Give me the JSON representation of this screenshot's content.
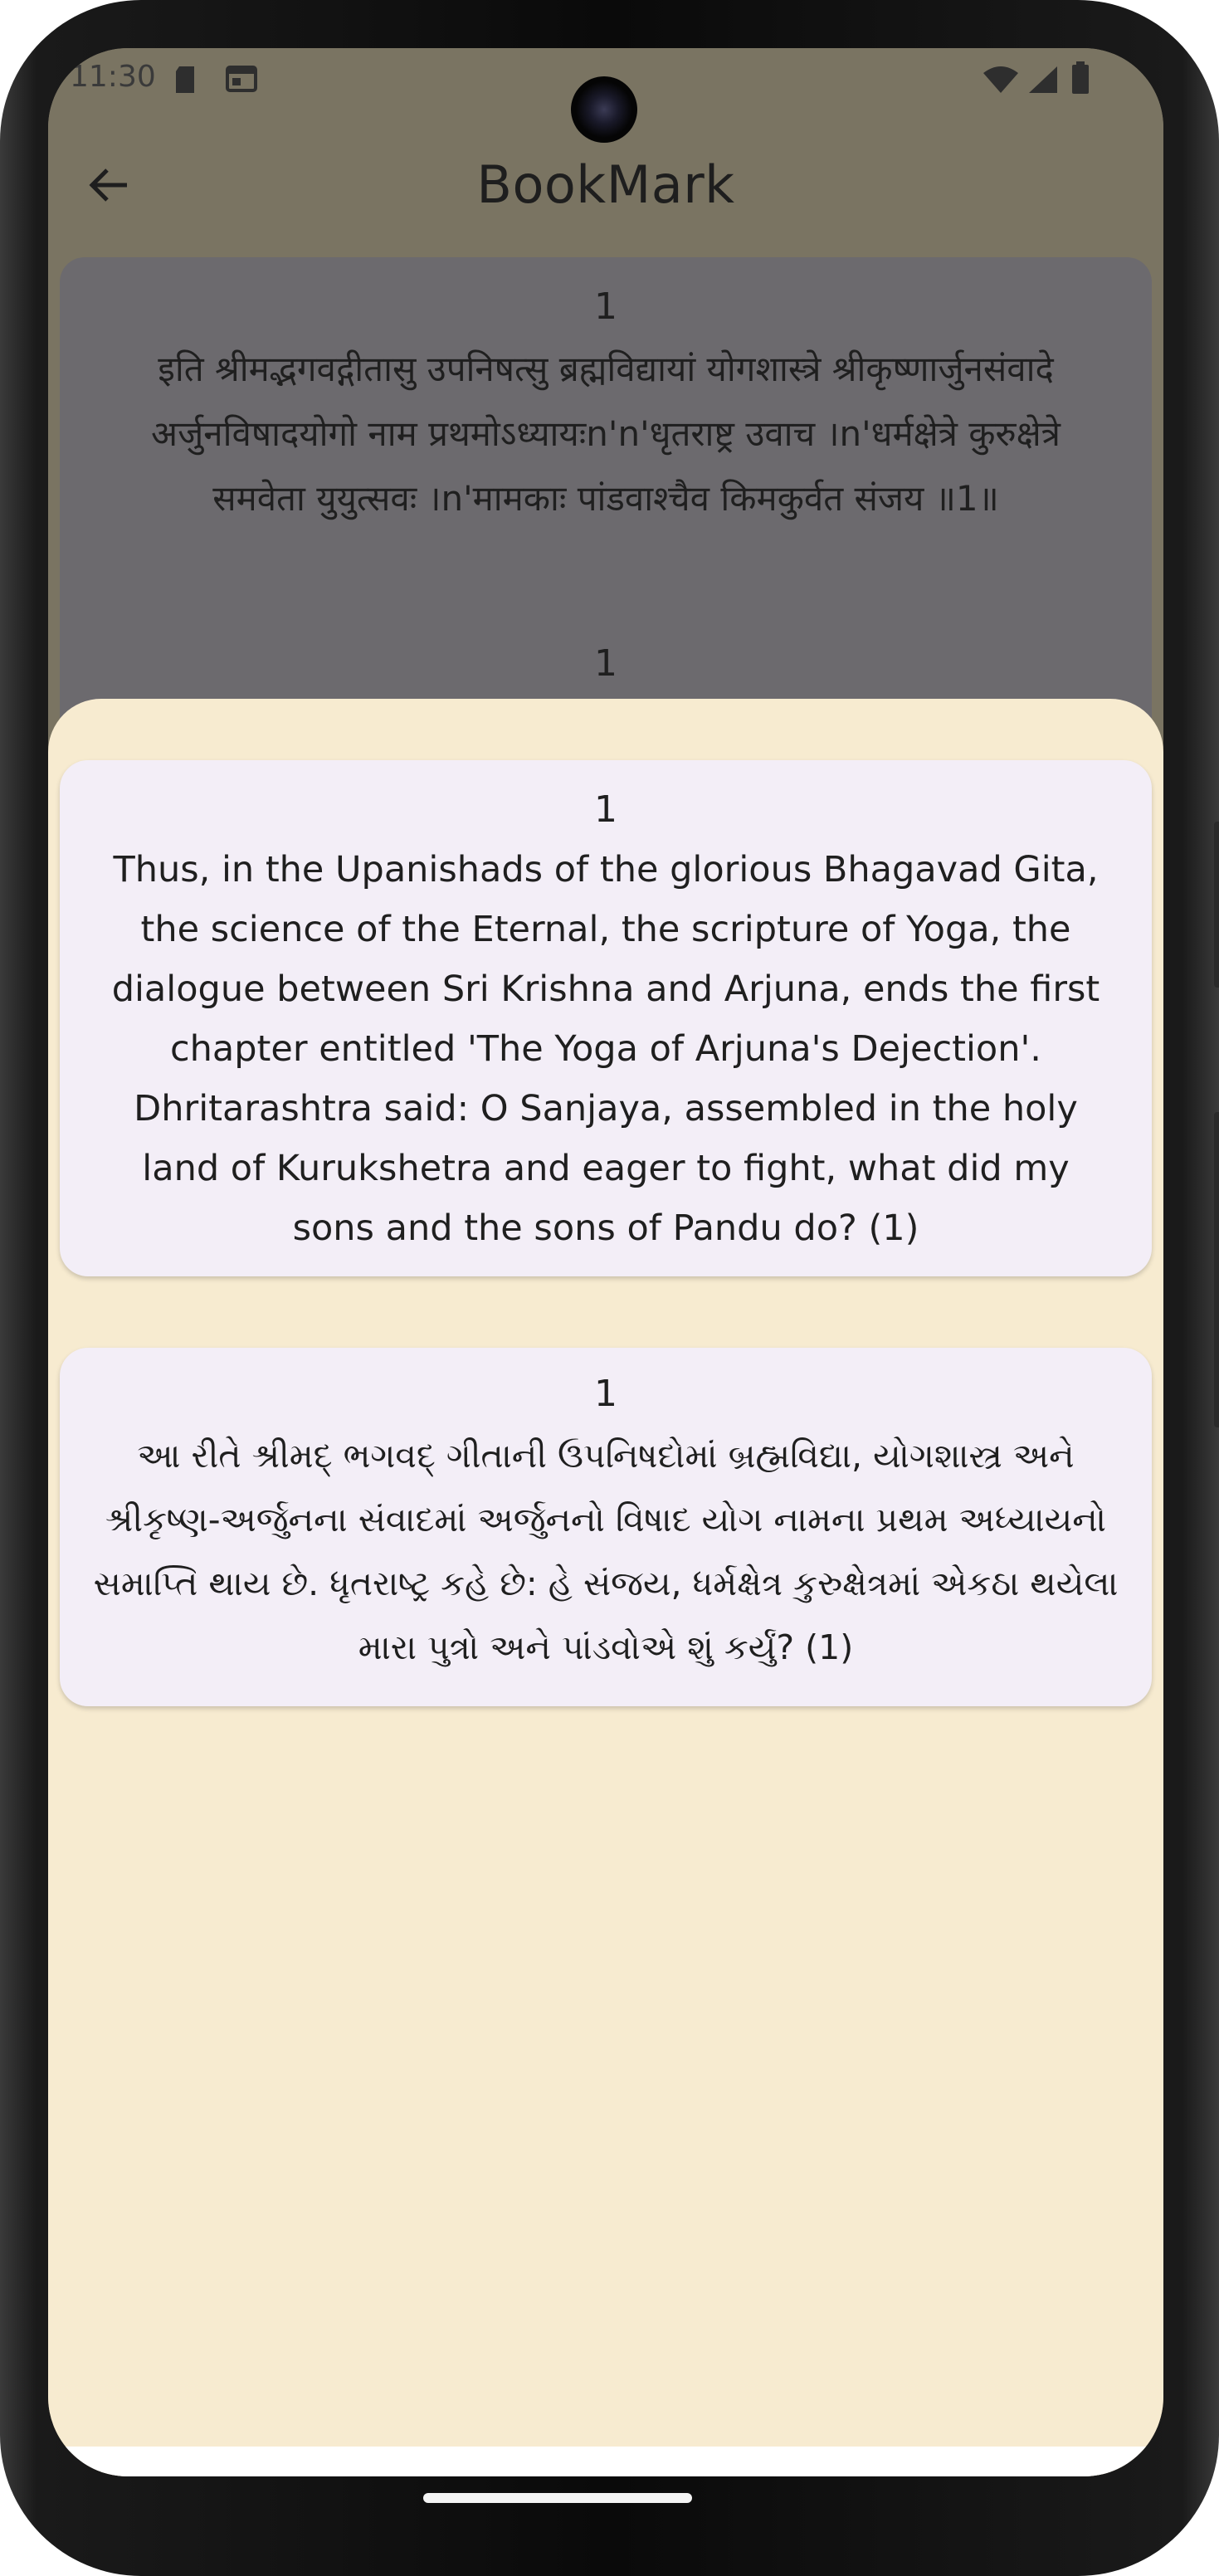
{
  "status_bar": {
    "time": "11:30",
    "icons": [
      "sd-card-icon",
      "calendar-icon",
      "wifi-icon",
      "signal-icon",
      "battery-icon"
    ]
  },
  "toolbar": {
    "title": "BookMark",
    "back_icon": "arrow-back-icon"
  },
  "background_list": {
    "items": [
      {
        "number": "1",
        "text": "इति श्रीमद्भगवद्गीतासु उपनिषत्सु ब्रह्मविद्यायां योगशास्त्रे श्रीकृष्णार्जुनसंवादे अर्जुनविषादयोगो नाम प्रथमोऽध्यायःn'n'धृतराष्ट्र उवाच ।n'धर्मक्षेत्रे कुरुक्षेत्रे समवेता युयुत्सवः ।n'मामकाः पांडवाश्चैव किमकुर्वत संजय ॥1॥"
      },
      {
        "number": "1",
        "text": ""
      }
    ]
  },
  "sheet": {
    "cards": [
      {
        "number": "1",
        "text": "Thus, in the Upanishads of the glorious Bhagavad Gita, the science of the Eternal, the scripture of Yoga, the dialogue between Sri Krishna and Arjuna, ends the first chapter entitled 'The Yoga of Arjuna's Dejection'. Dhritarashtra said: O Sanjaya, assembled in the holy land of Kurukshetra and eager to fight, what did my sons and the sons of Pandu do? (1)"
      },
      {
        "number": "1",
        "text": "આ રીતે શ્રીમદ્ ભગવદ્ ગીતાની ઉપનિષદોમાં બ્રહ્મવિદ્યા, યોગશાસ્ત્ર અને શ્રીકૃષ્ણ-અર્જુનના સંવાદમાં અર્જુનનો વિષાદ યોગ નામના પ્રથમ અધ્યાયનો સમાપ્તિ થાય છે. ધૃતરાષ્ટ્ર કહે છે: હે સંજય, ધર્મક્ષેત્ર કુરુક્ષેત્રમાં એકઠા થયેલા મારા પુત્રો અને પાંડવોએ શું કર્યું? (1)"
      }
    ]
  },
  "colors": {
    "scrim": "#7a7462",
    "sheet": "#f7ebd0",
    "card": "#f3eef7",
    "text": "#1f1f1f"
  }
}
